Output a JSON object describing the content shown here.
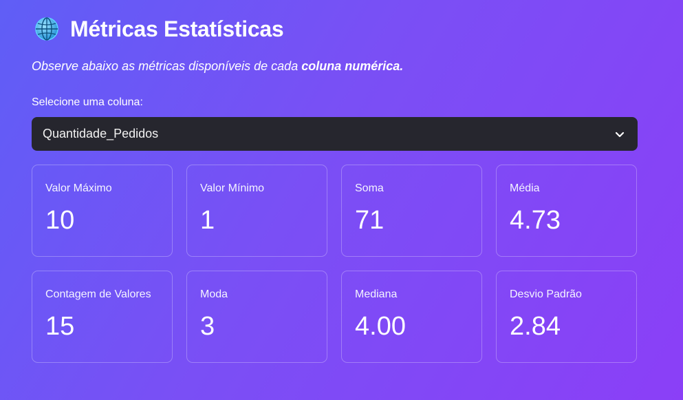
{
  "header": {
    "title": "Métricas Estatísticas",
    "icon": "globe-icon"
  },
  "subtitle": {
    "prefix": "Observe abaixo as métricas disponíveis de cada ",
    "bold": "coluna numérica."
  },
  "selector": {
    "label": "Selecione uma coluna:",
    "value": "Quantidade_Pedidos"
  },
  "metrics": [
    {
      "label": "Valor Máximo",
      "value": "10"
    },
    {
      "label": "Valor Mínimo",
      "value": "1"
    },
    {
      "label": "Soma",
      "value": "71"
    },
    {
      "label": "Média",
      "value": "4.73"
    },
    {
      "label": "Contagem de Valores",
      "value": "15"
    },
    {
      "label": "Moda",
      "value": "3"
    },
    {
      "label": "Mediana",
      "value": "4.00"
    },
    {
      "label": "Desvio Padrão",
      "value": "2.84"
    }
  ],
  "colors": {
    "gradient_start": "#5f5ef6",
    "gradient_end": "#8b3ff7",
    "select_background": "#26262e"
  }
}
